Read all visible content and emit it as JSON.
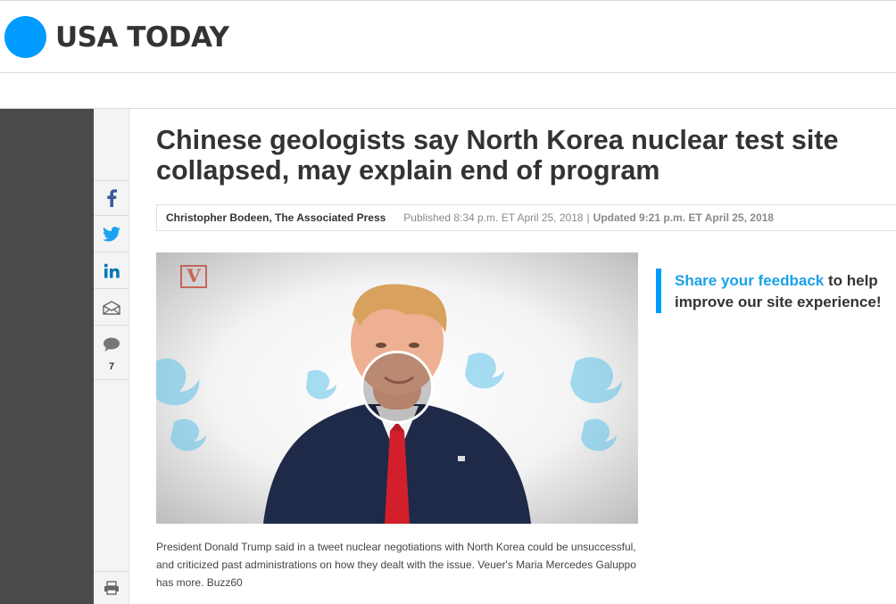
{
  "header": {
    "logo_text": "USA TODAY",
    "brand_color": "#009bff"
  },
  "share": {
    "facebook_icon": "facebook-icon",
    "twitter_icon": "twitter-icon",
    "linkedin_icon": "linkedin-icon",
    "email_icon": "email-icon",
    "comments_icon": "comments-icon",
    "comments_count": "7",
    "print_icon": "print-icon"
  },
  "article": {
    "headline": "Chinese geologists say North Korea nuclear test site collapsed, may explain end of program",
    "author": "Christopher Bodeen, The Associated Press",
    "published": "Published 8:34 p.m. ET April 25, 2018",
    "separator": "|",
    "updated": "Updated 9:21 p.m. ET April 25, 2018",
    "video_brand": "V",
    "caption": "President Donald Trump said in a tweet nuclear negotiations with North Korea could be unsuccessful, and criticized past administrations on how they dealt with the issue. Veuer's Maria Mercedes Galuppo has more. Buzz60"
  },
  "feedback": {
    "link_text": "Share your feedback",
    "rest_text": " to help improve our site experience!"
  }
}
